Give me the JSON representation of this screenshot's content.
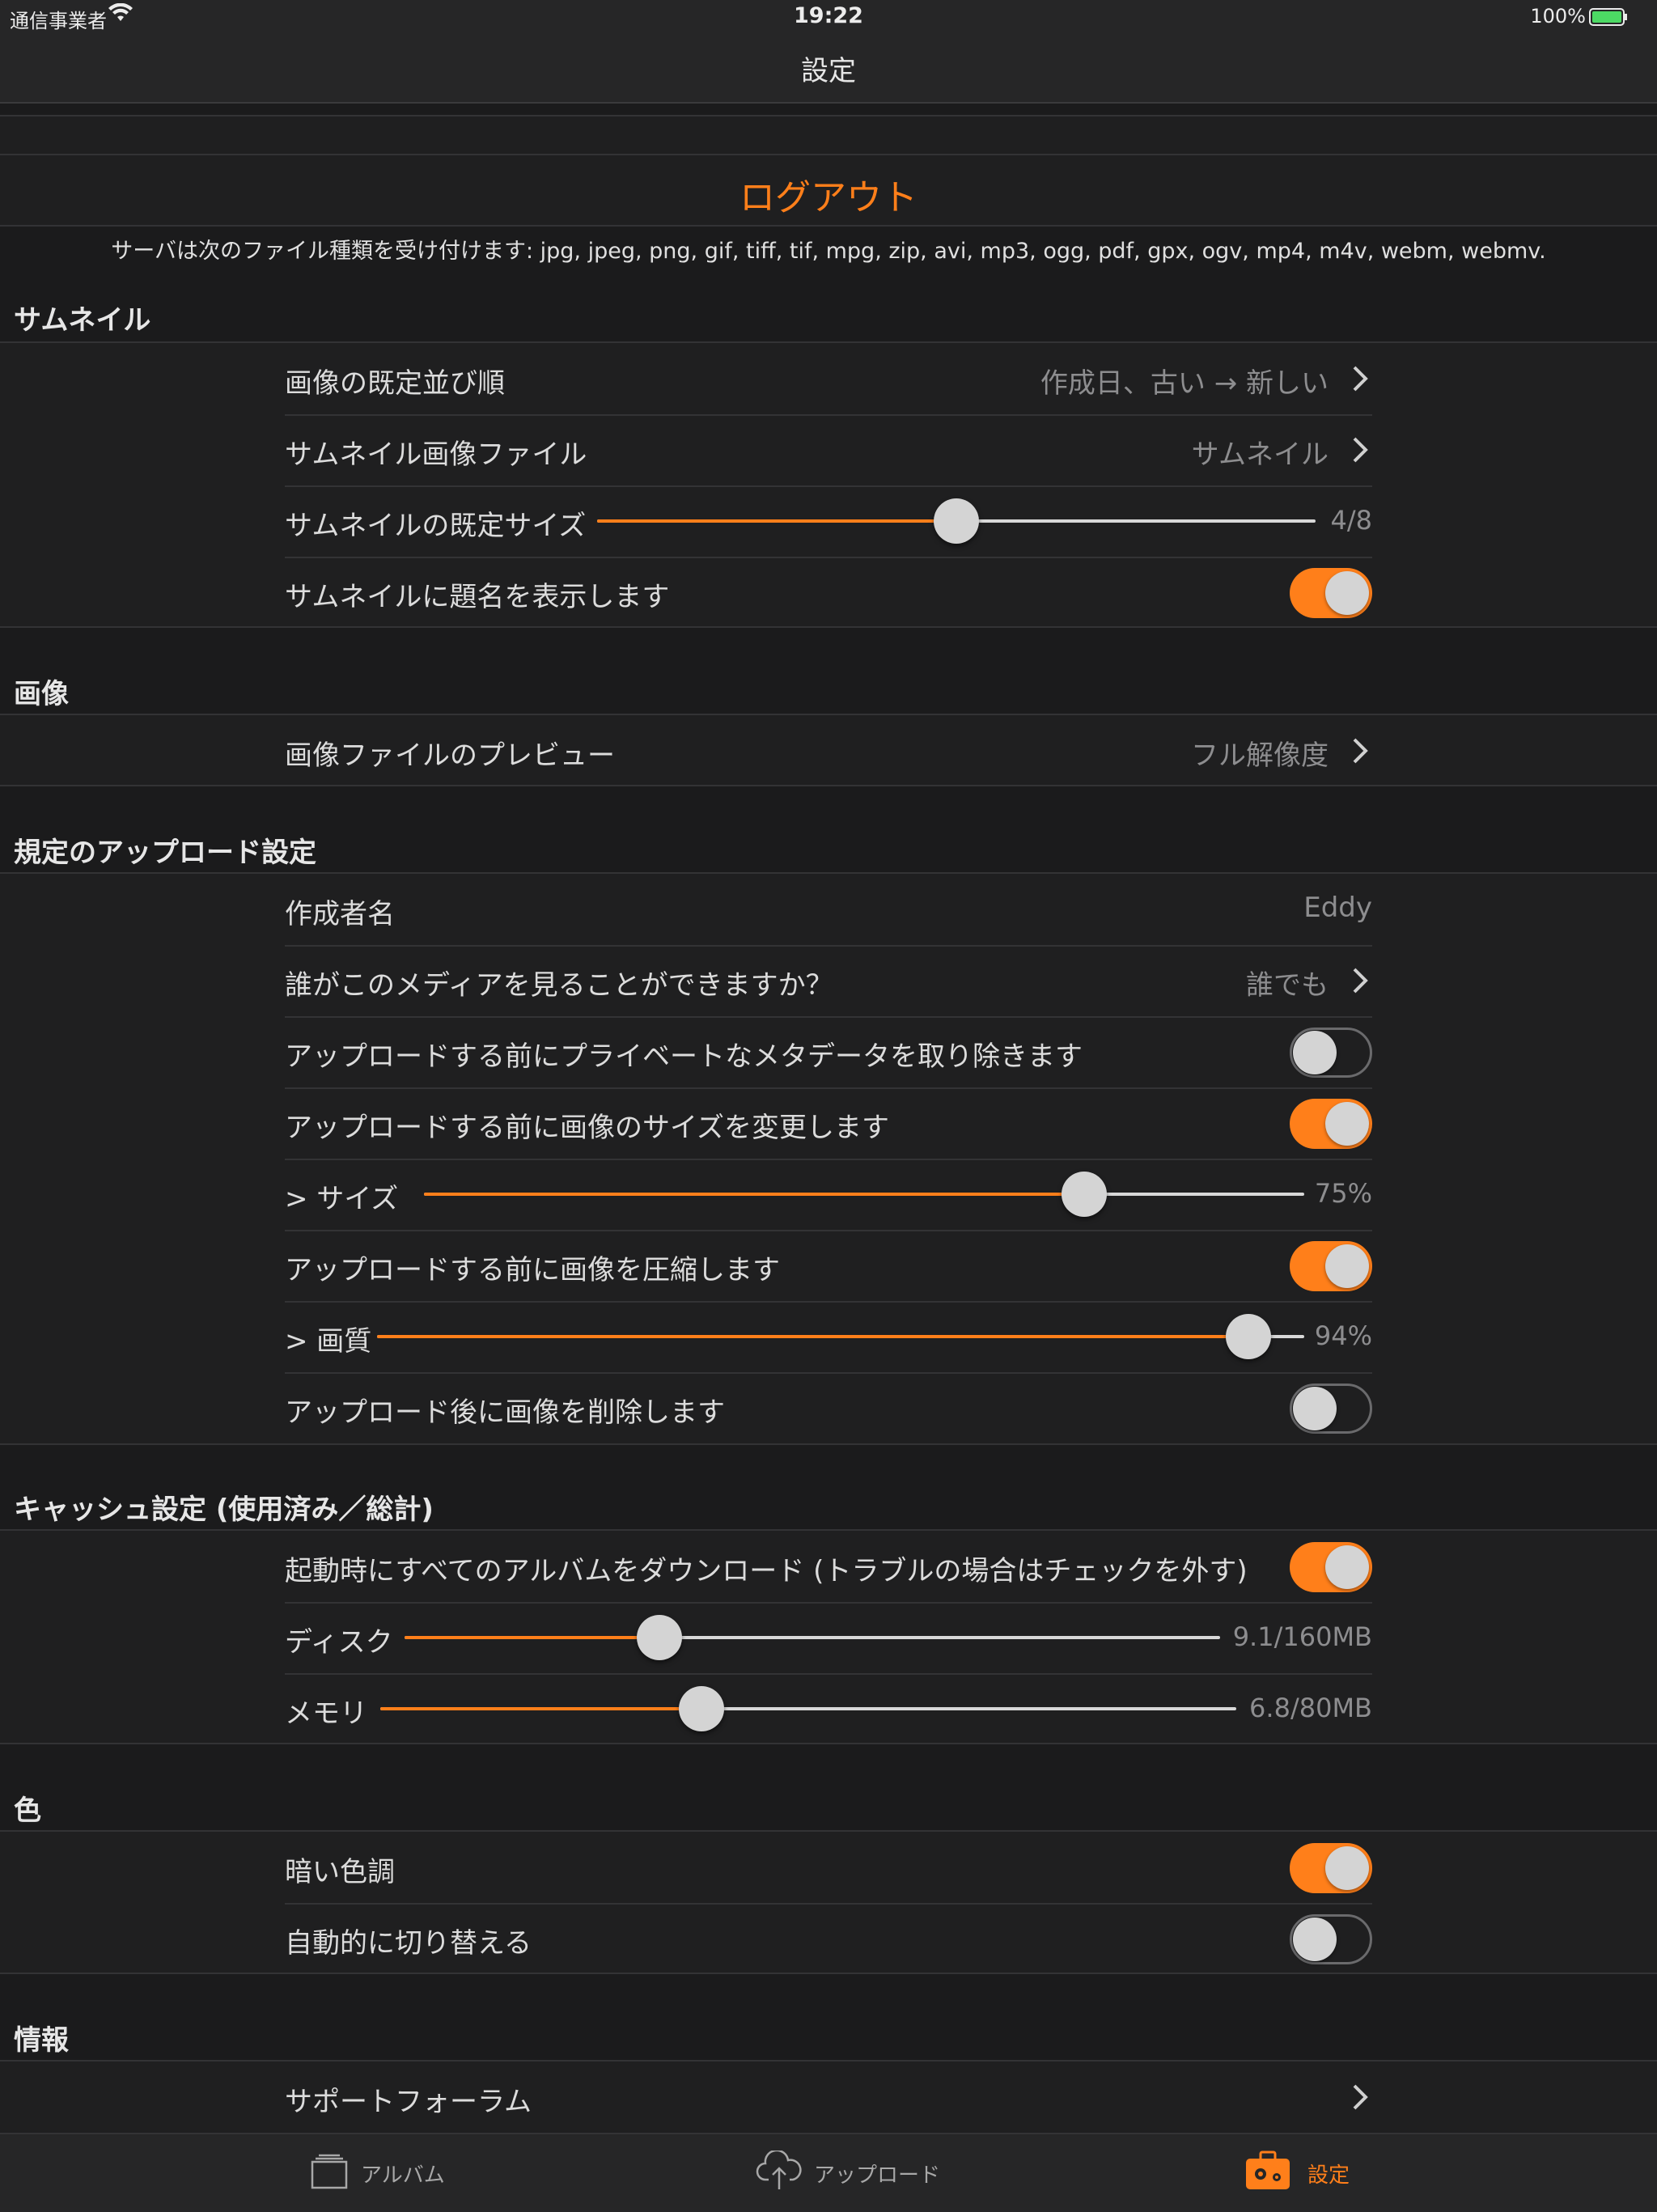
{
  "status_bar": {
    "carrier": "通信事業者",
    "time": "19:22",
    "battery": "100%"
  },
  "nav": {
    "title": "設定"
  },
  "logout": {
    "label": "ログアウト"
  },
  "file_types_note": "サーバは次のファイル種類を受け付けます: jpg, jpeg, png, gif, tiff, tif, mpg, zip, avi, mp3, ogg, pdf, gpx, ogv, mp4, m4v, webm, webmv.",
  "thumbnails": {
    "header": "サムネイル",
    "sort_label": "画像の既定並び順",
    "sort_value": "作成日、古い → 新しい",
    "file_label": "サムネイル画像ファイル",
    "file_value": "サムネイル",
    "size_label": "サムネイルの既定サイズ",
    "size_value": "4/8",
    "size_level": 0.5,
    "show_title_label": "サムネイルに題名を表示します",
    "show_title_on": true
  },
  "images": {
    "header": "画像",
    "preview_label": "画像ファイルのプレビュー",
    "preview_value": "フル解像度"
  },
  "upload": {
    "header": "規定のアップロード設定",
    "author_label": "作成者名",
    "author_value": "Eddy",
    "privacy_label": "誰がこのメディアを見ることができますか？",
    "privacy_value": "誰でも",
    "strip_meta_label": "アップロードする前にプライベートなメタデータを取り除きます",
    "strip_meta_on": false,
    "resize_label": "アップロードする前に画像のサイズを変更します",
    "resize_on": true,
    "size_label": "> サイズ",
    "size_value": "75%",
    "size_level": 0.75,
    "compress_label": "アップロードする前に画像を圧縮します",
    "compress_on": true,
    "quality_label": "> 画質",
    "quality_value": "94%",
    "quality_level": 0.94,
    "delete_label": "アップロード後に画像を削除します",
    "delete_on": false
  },
  "cache": {
    "header": "キャッシュ設定 (使用済み／総計)",
    "download_all_label": "起動時にすべてのアルバムをダウンロード (トラブルの場合はチェックを外す)",
    "download_all_on": true,
    "disk_label": "ディスク",
    "disk_value": "9.1/160MB",
    "disk_level": 0.3125,
    "memory_label": "メモリ",
    "memory_value": "6.8/80MB",
    "memory_level": 0.375
  },
  "color": {
    "header": "色",
    "dark_label": "暗い色調",
    "dark_on": true,
    "auto_label": "自動的に切り替える",
    "auto_on": false
  },
  "info": {
    "header": "情報",
    "forum_label": "サポートフォーラム"
  },
  "tabs": [
    {
      "label": "アルバム",
      "icon": "albums-icon",
      "active": false
    },
    {
      "label": "アップロード",
      "icon": "cloud-upload-icon",
      "active": false
    },
    {
      "label": "設定",
      "icon": "settings-toolbox-icon",
      "active": true
    }
  ],
  "colors": {
    "accent": "#ff7f1a",
    "background": "#1b1b1c",
    "cell": "#1f1f20"
  }
}
